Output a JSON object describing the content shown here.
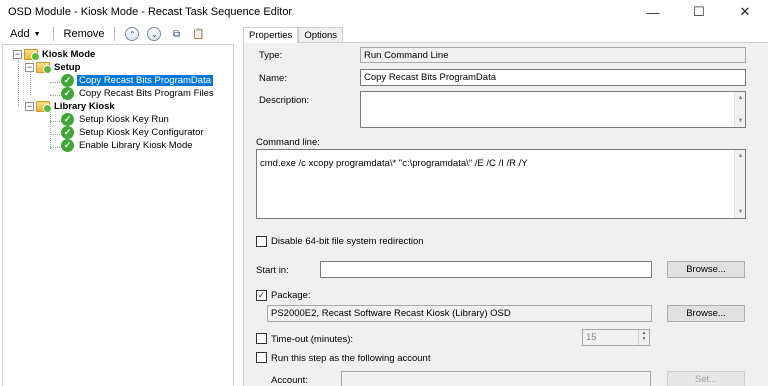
{
  "window": {
    "title": "OSD Module - Kiosk Mode - Recast Task Sequence Editor",
    "minimize_glyph": "—",
    "maximize_glyph": "☐",
    "close_glyph": "✕"
  },
  "toolbar": {
    "add_label": "Add",
    "remove_label": "Remove",
    "icons": [
      "move-up-icon",
      "move-down-icon",
      "copy-icon",
      "paste-icon"
    ]
  },
  "tree": {
    "root": "Kiosk Mode",
    "setup": "Setup",
    "setup_items": [
      "Copy Recast Bits ProgramData",
      "Copy Recast Bits Program Files"
    ],
    "library": "Library Kiosk",
    "library_items": [
      "Setup Kiosk Key Run",
      "Setup Kiosk Key Configurator",
      "Enable Library Kiosk Mode"
    ],
    "selected": "Copy Recast Bits ProgramData"
  },
  "tabs": [
    "Properties",
    "Options"
  ],
  "properties": {
    "type_label": "Type:",
    "type_value": "Run Command Line",
    "name_label": "Name:",
    "name_value": "Copy Recast Bits ProgramData",
    "description_label": "Description:",
    "description_value": "",
    "command_label": "Command line:",
    "command_value": "cmd.exe /c xcopy programdata\\* \"c:\\programdata\\\" /E /C /I /R /Y",
    "disable64_label": "Disable 64-bit file system redirection",
    "disable64_checked": false,
    "startin_label": "Start in:",
    "startin_value": "",
    "browse_label": "Browse...",
    "package_label": "Package:",
    "package_checked": true,
    "package_value": "PS2000E2, Recast Software Recast Kiosk (Library) OSD",
    "timeout_label": "Time-out (minutes):",
    "timeout_checked": false,
    "timeout_value": "15",
    "runas_label": "Run this step as the following account",
    "runas_checked": false,
    "account_label": "Account:",
    "account_value": "",
    "set_label": "Set..."
  }
}
